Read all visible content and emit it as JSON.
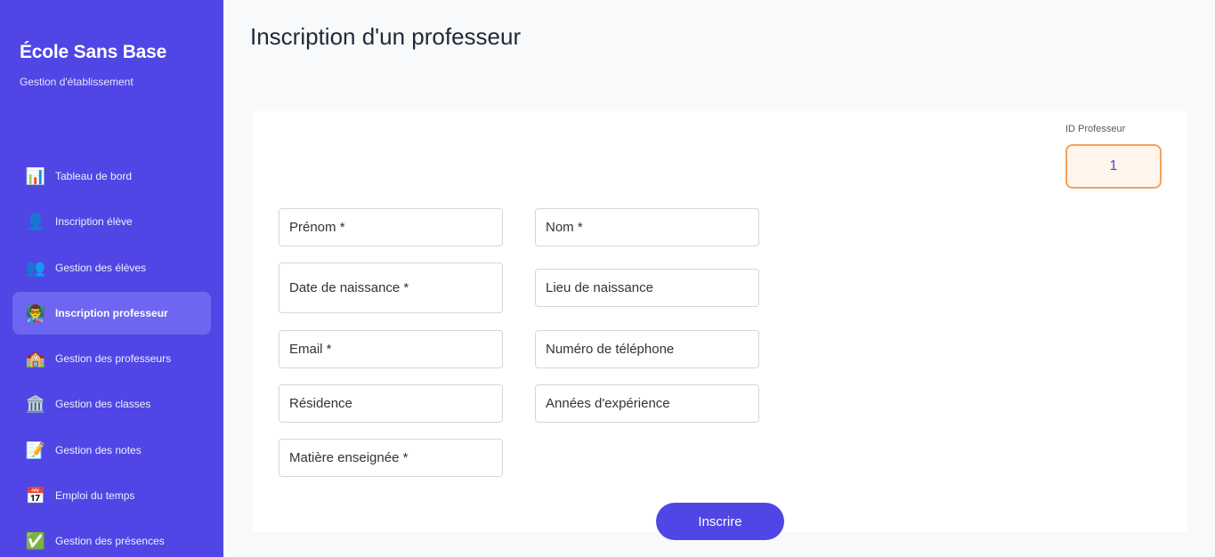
{
  "sidebar": {
    "brand": "École Sans Base",
    "subtitle": "Gestion d'établissement",
    "items": [
      {
        "label": "Tableau de bord",
        "icon": "📊",
        "icon_name": "chart-icon"
      },
      {
        "label": "Inscription élève",
        "icon": "👤",
        "icon_name": "user-icon"
      },
      {
        "label": "Gestion des élèves",
        "icon": "👥",
        "icon_name": "users-icon"
      },
      {
        "label": "Inscription professeur",
        "icon": "👨‍🏫",
        "icon_name": "teacher-icon"
      },
      {
        "label": "Gestion des professeurs",
        "icon": "🏫",
        "icon_name": "school-icon"
      },
      {
        "label": "Gestion des classes",
        "icon": "🏛️",
        "icon_name": "building-icon"
      },
      {
        "label": "Gestion des notes",
        "icon": "📝",
        "icon_name": "memo-icon"
      },
      {
        "label": "Emploi du temps",
        "icon": "📅",
        "icon_name": "calendar-icon"
      },
      {
        "label": "Gestion des présences",
        "icon": "✅",
        "icon_name": "check-icon"
      }
    ],
    "active_item": "Inscription professeur"
  },
  "page": {
    "title": "Inscription d'un professeur"
  },
  "form": {
    "id_label": "ID Professeur",
    "id_value": "1",
    "fields": {
      "prenom": "Prénom *",
      "nom": "Nom *",
      "date_naissance": "Date de naissance *",
      "lieu_naissance": "Lieu de naissance",
      "email": "Email *",
      "telephone": "Numéro de téléphone",
      "residence": "Résidence",
      "experience": "Années d'expérience",
      "matiere": "Matière enseignée *"
    },
    "submit_label": "Inscrire"
  },
  "colors": {
    "sidebar_bg": "#4f46e5",
    "active_item_bg": "#6d66f0",
    "id_border": "#f4a25e",
    "primary": "#4f46e5"
  }
}
